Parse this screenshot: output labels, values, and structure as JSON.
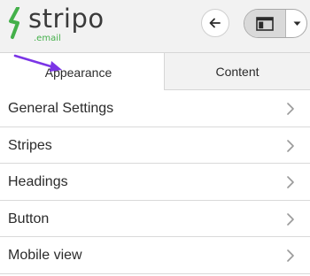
{
  "logo": {
    "word": "stripo",
    "sub": ".email"
  },
  "header": {
    "back_icon": "arrow-left-icon",
    "view_icon": "layout-panel-icon",
    "dropdown_icon": "caret-down-icon"
  },
  "tabs": [
    {
      "label": "Appearance",
      "active": true
    },
    {
      "label": "Content",
      "active": false
    }
  ],
  "settings": {
    "items": [
      {
        "label": "General Settings"
      },
      {
        "label": "Stripes"
      },
      {
        "label": "Headings"
      },
      {
        "label": "Button"
      },
      {
        "label": "Mobile view"
      }
    ]
  },
  "colors": {
    "brand_green": "#44b04a",
    "annotation_arrow": "#7b35e6",
    "tab_inactive_bg": "#f2f2f2"
  }
}
